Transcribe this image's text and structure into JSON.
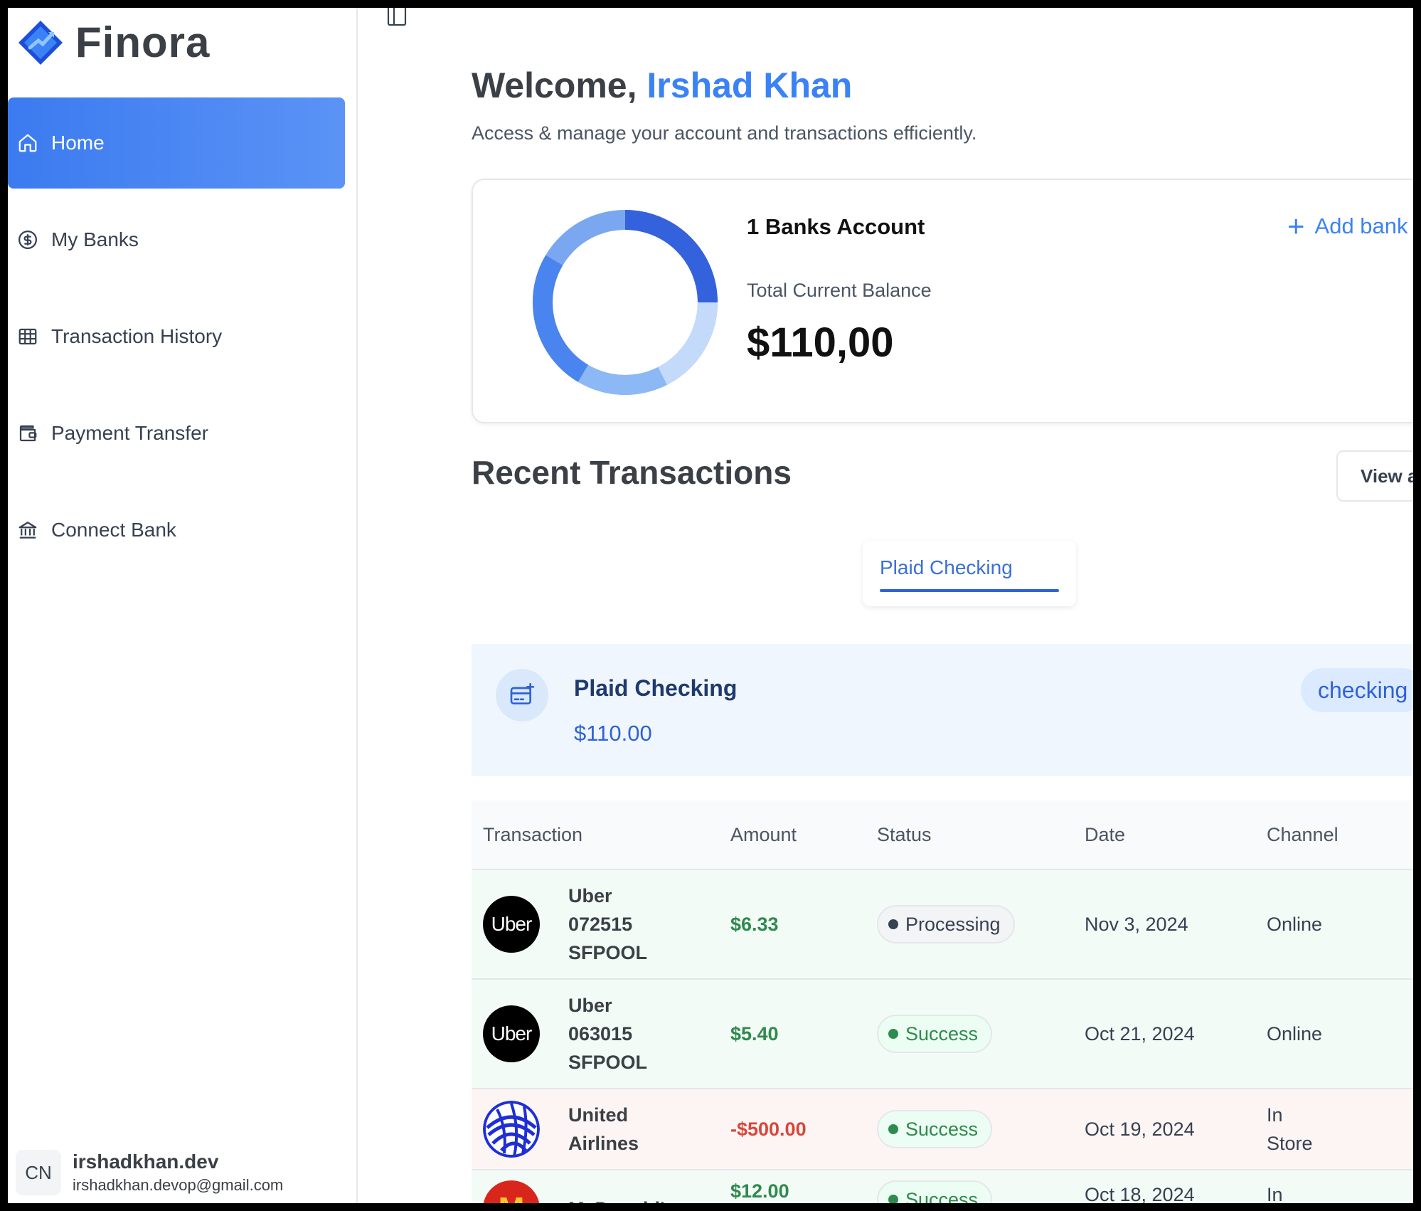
{
  "app": {
    "name": "Finora"
  },
  "sidebar": {
    "items": [
      {
        "label": "Home",
        "icon": "home-icon",
        "active": true
      },
      {
        "label": "My Banks",
        "icon": "dollar-circle-icon",
        "active": false
      },
      {
        "label": "Transaction History",
        "icon": "table-icon",
        "active": false
      },
      {
        "label": "Payment Transfer",
        "icon": "wallet-icon",
        "active": false
      },
      {
        "label": "Connect Bank",
        "icon": "bank-icon",
        "active": false
      }
    ],
    "user": {
      "initials": "CN",
      "name": "irshadkhan.dev",
      "email": "irshadkhan.devop@gmail.com"
    }
  },
  "header": {
    "greeting": "Welcome,",
    "user_name": "Irshad Khan",
    "subtext": "Access & manage your account and transactions efficiently."
  },
  "balance_card": {
    "bank_count": "1 Banks Account",
    "add_bank": "Add bank",
    "total_label": "Total Current Balance",
    "total_amount": "$110,00"
  },
  "recent": {
    "title": "Recent Transactions",
    "view_all": "View all",
    "tabs": [
      {
        "label": "Plaid Checking",
        "active": true
      }
    ],
    "account": {
      "name": "Plaid Checking",
      "balance": "$110.00",
      "type": "checking"
    },
    "columns": [
      "Transaction",
      "Amount",
      "Status",
      "Date",
      "Channel"
    ],
    "rows": [
      {
        "logo_text": "Uber",
        "name": "Uber 072515 SFPOOL",
        "amount": "$6.33",
        "status": "Processing",
        "date": "Nov 3, 2024",
        "channel": "Online"
      },
      {
        "logo_text": "Uber",
        "name": "Uber 063015 SFPOOL",
        "amount": "$5.40",
        "status": "Success",
        "date": "Oct 21, 2024",
        "channel": "Online"
      },
      {
        "logo_text": "",
        "name": "United Airlines",
        "amount": "-$500.00",
        "status": "Success",
        "date": "Oct 19, 2024",
        "channel": "In Store"
      },
      {
        "logo_text": "",
        "name": "McDonald's",
        "amount": "$12.00",
        "status": "Success",
        "date": "Oct 18, 2024",
        "channel": "In Store"
      }
    ]
  },
  "colors": {
    "accent": "#3b82f6",
    "credit_row": "#f3fbf6",
    "debit_row": "#fdf5f4",
    "success": "#2f8a4d",
    "negative": "#d9463a"
  }
}
